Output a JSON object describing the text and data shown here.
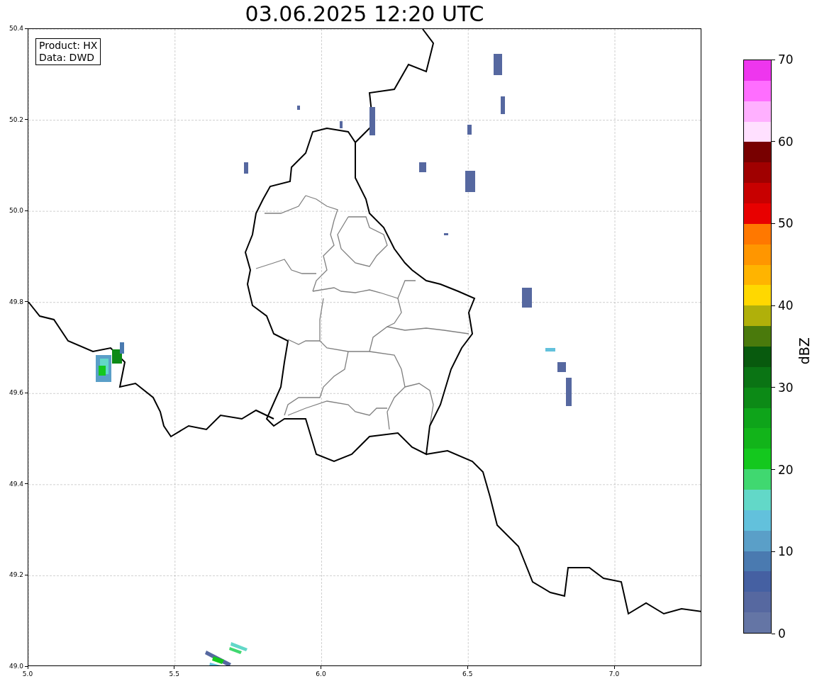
{
  "title": "03.06.2025 12:20 UTC",
  "info_box": {
    "lines": [
      "Product: HX",
      "Data: DWD"
    ]
  },
  "map": {
    "xticks": [
      "5.0",
      "5.5",
      "6.0",
      "6.5",
      "7.0"
    ],
    "yticks": [
      "50.4",
      "50.2",
      "50.0",
      "49.8",
      "49.6",
      "49.4",
      "49.2",
      "49.0"
    ]
  },
  "colorbar": {
    "label": "dBZ",
    "ticks": [
      "70",
      "60",
      "50",
      "40",
      "30",
      "20",
      "10",
      "0"
    ],
    "segments": [
      {
        "color": "#ee36ee"
      },
      {
        "color": "#ff6eff"
      },
      {
        "color": "#ffb0ff"
      },
      {
        "color": "#ffe0ff"
      },
      {
        "color": "#780000"
      },
      {
        "color": "#a00000"
      },
      {
        "color": "#c80000"
      },
      {
        "color": "#e80000"
      },
      {
        "color": "#ff7800"
      },
      {
        "color": "#ff9600"
      },
      {
        "color": "#ffb400"
      },
      {
        "color": "#ffd800"
      },
      {
        "color": "#b0b00a"
      },
      {
        "color": "#4a7a0c"
      },
      {
        "color": "#085a0e"
      },
      {
        "color": "#0a7414"
      },
      {
        "color": "#0c8a16"
      },
      {
        "color": "#0ea41a"
      },
      {
        "color": "#12b41a"
      },
      {
        "color": "#14c81e"
      },
      {
        "color": "#40d870"
      },
      {
        "color": "#62d8c8"
      },
      {
        "color": "#62c1dc"
      },
      {
        "color": "#5a9fc8"
      },
      {
        "color": "#4a7ab0"
      },
      {
        "color": "#4560a2"
      },
      {
        "color": "#5668a0"
      },
      {
        "color": "#6475a5"
      }
    ]
  }
}
